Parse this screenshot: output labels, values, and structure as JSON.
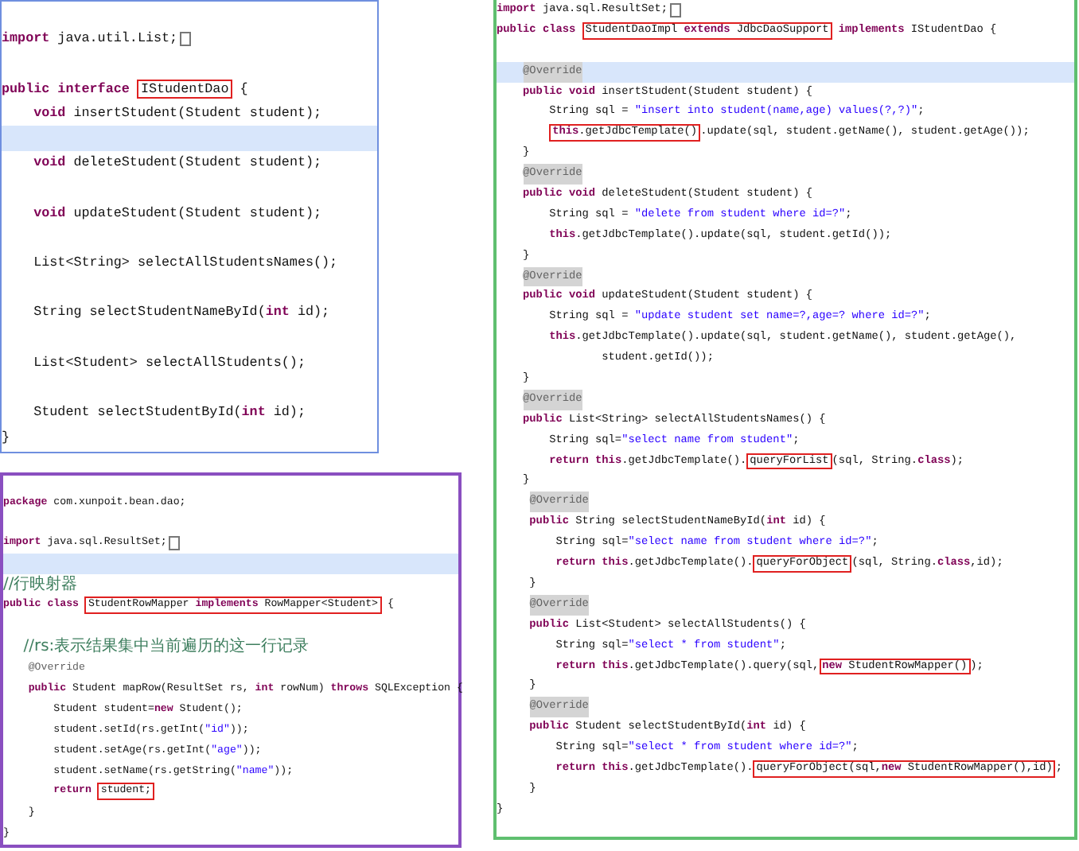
{
  "panels": [
    {
      "color": "#6f8fdf",
      "lines": [
        {
          "kind": "blank",
          "highlighted": false
        },
        {
          "kind": "code",
          "highlighted": false,
          "segments": [
            {
              "kind": "code",
              "tokens": [
                {
                  "kind": "keyword",
                  "text": "import"
                },
                {
                  "kind": "plain",
                  "text": " java.util.List;"
                }
              ]
            },
            {
              "kind": "fold"
            }
          ]
        },
        {
          "kind": "blank",
          "highlighted": false
        },
        {
          "kind": "code",
          "highlighted": false,
          "segments": [
            {
              "kind": "code",
              "tokens": [
                {
                  "kind": "keyword",
                  "text": "public interface "
                }
              ]
            },
            {
              "kind": "boxed",
              "tokens": [
                {
                  "kind": "plain",
                  "text": "IStudentDao"
                }
              ]
            },
            {
              "kind": "code",
              "tokens": [
                {
                  "kind": "plain",
                  "text": " {"
                }
              ]
            }
          ]
        },
        {
          "kind": "code",
          "highlighted": false,
          "segments": [
            {
              "kind": "code",
              "tokens": [
                {
                  "kind": "keyword",
                  "text": "    void"
                },
                {
                  "kind": "plain",
                  "text": " insertStudent(Student student);"
                }
              ]
            }
          ]
        },
        {
          "kind": "blank",
          "highlighted": true
        },
        {
          "kind": "code",
          "highlighted": false,
          "segments": [
            {
              "kind": "code",
              "tokens": [
                {
                  "kind": "keyword",
                  "text": "    void"
                },
                {
                  "kind": "plain",
                  "text": " deleteStudent(Student student);"
                }
              ]
            }
          ]
        },
        {
          "kind": "blank",
          "highlighted": false
        },
        {
          "kind": "code",
          "highlighted": false,
          "segments": [
            {
              "kind": "code",
              "tokens": [
                {
                  "kind": "keyword",
                  "text": "    void"
                },
                {
                  "kind": "plain",
                  "text": " updateStudent(Student student);"
                }
              ]
            }
          ]
        },
        {
          "kind": "blank",
          "highlighted": false
        },
        {
          "kind": "code",
          "highlighted": false,
          "segments": [
            {
              "kind": "code",
              "tokens": [
                {
                  "kind": "plain",
                  "text": "    List<String> selectAllStudentsNames();"
                }
              ]
            }
          ]
        },
        {
          "kind": "blank",
          "highlighted": false
        },
        {
          "kind": "code",
          "highlighted": false,
          "segments": [
            {
              "kind": "code",
              "tokens": [
                {
                  "kind": "plain",
                  "text": "    String selectStudentNameById("
                },
                {
                  "kind": "keyword",
                  "text": "int"
                },
                {
                  "kind": "plain",
                  "text": " id);"
                }
              ]
            }
          ]
        },
        {
          "kind": "blank",
          "highlighted": false
        },
        {
          "kind": "code",
          "highlighted": false,
          "segments": [
            {
              "kind": "code",
              "tokens": [
                {
                  "kind": "plain",
                  "text": "    List<Student> selectAllStudents();"
                }
              ]
            }
          ]
        },
        {
          "kind": "blank",
          "highlighted": false
        },
        {
          "kind": "code",
          "highlighted": false,
          "segments": [
            {
              "kind": "code",
              "tokens": [
                {
                  "kind": "plain",
                  "text": "    Student selectStudentById("
                },
                {
                  "kind": "keyword",
                  "text": "int"
                },
                {
                  "kind": "plain",
                  "text": " id);"
                }
              ]
            }
          ]
        },
        {
          "kind": "code",
          "highlighted": false,
          "segments": [
            {
              "kind": "code",
              "tokens": [
                {
                  "kind": "plain",
                  "text": "}"
                }
              ]
            }
          ]
        }
      ]
    },
    {
      "color": "#8a4fc0",
      "lines": [
        {
          "kind": "code",
          "highlighted": false,
          "segments": [
            {
              "kind": "code",
              "tokens": [
                {
                  "kind": "keyword",
                  "text": "package"
                },
                {
                  "kind": "plain",
                  "text": " com.xunpoit.bean.dao;"
                }
              ]
            }
          ]
        },
        {
          "kind": "blank",
          "highlighted": false
        },
        {
          "kind": "code",
          "highlighted": false,
          "segments": [
            {
              "kind": "code",
              "tokens": [
                {
                  "kind": "keyword",
                  "text": "import"
                },
                {
                  "kind": "plain",
                  "text": " java.sql.ResultSet;"
                }
              ]
            },
            {
              "kind": "fold"
            }
          ]
        },
        {
          "kind": "blank",
          "highlighted": true
        },
        {
          "kind": "code",
          "highlighted": false,
          "segments": [
            {
              "kind": "code",
              "tokens": [
                {
                  "kind": "comment",
                  "text": "//行映射器"
                }
              ]
            }
          ]
        },
        {
          "kind": "code",
          "highlighted": false,
          "segments": [
            {
              "kind": "code",
              "tokens": [
                {
                  "kind": "keyword",
                  "text": "public class "
                }
              ]
            },
            {
              "kind": "boxed",
              "tokens": [
                {
                  "kind": "plain",
                  "text": "StudentRowMapper "
                },
                {
                  "kind": "keyword",
                  "text": "implements"
                },
                {
                  "kind": "plain",
                  "text": " RowMapper<Student>"
                }
              ]
            },
            {
              "kind": "code",
              "tokens": [
                {
                  "kind": "plain",
                  "text": " {"
                }
              ]
            }
          ]
        },
        {
          "kind": "blank",
          "highlighted": false
        },
        {
          "kind": "code",
          "highlighted": false,
          "segments": [
            {
              "kind": "code",
              "tokens": [
                {
                  "kind": "comment",
                  "text": "    //rs:表示结果集中当前遍历的这一行记录"
                }
              ]
            }
          ]
        },
        {
          "kind": "code",
          "highlighted": false,
          "segments": [
            {
              "kind": "code",
              "tokens": [
                {
                  "kind": "annotation",
                  "text": "    @Override"
                }
              ]
            }
          ]
        },
        {
          "kind": "code",
          "highlighted": false,
          "segments": [
            {
              "kind": "code",
              "tokens": [
                {
                  "kind": "keyword",
                  "text": "    public"
                },
                {
                  "kind": "plain",
                  "text": " Student mapRow(ResultSet rs, "
                },
                {
                  "kind": "keyword",
                  "text": "int"
                },
                {
                  "kind": "plain",
                  "text": " rowNum) "
                },
                {
                  "kind": "keyword",
                  "text": "throws"
                },
                {
                  "kind": "plain",
                  "text": " SQLException {"
                }
              ]
            }
          ]
        },
        {
          "kind": "code",
          "highlighted": false,
          "segments": [
            {
              "kind": "code",
              "tokens": [
                {
                  "kind": "plain",
                  "text": "        Student student="
                },
                {
                  "kind": "keyword",
                  "text": "new"
                },
                {
                  "kind": "plain",
                  "text": " Student();"
                }
              ]
            }
          ]
        },
        {
          "kind": "code",
          "highlighted": false,
          "segments": [
            {
              "kind": "code",
              "tokens": [
                {
                  "kind": "plain",
                  "text": "        student.setId(rs.getInt("
                },
                {
                  "kind": "string",
                  "text": "\"id\""
                },
                {
                  "kind": "plain",
                  "text": "));"
                }
              ]
            }
          ]
        },
        {
          "kind": "code",
          "highlighted": false,
          "segments": [
            {
              "kind": "code",
              "tokens": [
                {
                  "kind": "plain",
                  "text": "        student.setAge(rs.getInt("
                },
                {
                  "kind": "string",
                  "text": "\"age\""
                },
                {
                  "kind": "plain",
                  "text": "));"
                }
              ]
            }
          ]
        },
        {
          "kind": "code",
          "highlighted": false,
          "segments": [
            {
              "kind": "code",
              "tokens": [
                {
                  "kind": "plain",
                  "text": "        student.setName(rs.getString("
                },
                {
                  "kind": "string",
                  "text": "\"name\""
                },
                {
                  "kind": "plain",
                  "text": "));"
                }
              ]
            }
          ]
        },
        {
          "kind": "code",
          "highlighted": false,
          "segments": [
            {
              "kind": "code",
              "tokens": [
                {
                  "kind": "keyword",
                  "text": "        return "
                }
              ]
            },
            {
              "kind": "boxed",
              "tokens": [
                {
                  "kind": "plain",
                  "text": "student;"
                }
              ]
            }
          ]
        },
        {
          "kind": "code",
          "highlighted": false,
          "segments": [
            {
              "kind": "code",
              "tokens": [
                {
                  "kind": "plain",
                  "text": "    }"
                }
              ]
            }
          ]
        },
        {
          "kind": "code",
          "highlighted": false,
          "segments": [
            {
              "kind": "code",
              "tokens": [
                {
                  "kind": "plain",
                  "text": "}"
                }
              ]
            }
          ]
        }
      ]
    },
    {
      "color": "#5fbf6f",
      "lines": [
        {
          "kind": "code",
          "highlighted": false,
          "segments": [
            {
              "kind": "code",
              "tokens": [
                {
                  "kind": "keyword",
                  "text": "import"
                },
                {
                  "kind": "plain",
                  "text": " java.sql.ResultSet;"
                }
              ]
            },
            {
              "kind": "fold"
            }
          ]
        },
        {
          "kind": "code",
          "highlighted": false,
          "segments": [
            {
              "kind": "code",
              "tokens": [
                {
                  "kind": "keyword",
                  "text": "public class "
                }
              ]
            },
            {
              "kind": "boxed",
              "tokens": [
                {
                  "kind": "plain",
                  "text": "StudentDaoImpl "
                },
                {
                  "kind": "keyword",
                  "text": "extends"
                },
                {
                  "kind": "plain",
                  "text": " JdbcDaoSupport"
                }
              ]
            },
            {
              "kind": "code",
              "tokens": [
                {
                  "kind": "keyword",
                  "text": " implements"
                },
                {
                  "kind": "plain",
                  "text": " IStudentDao {"
                }
              ]
            }
          ]
        },
        {
          "kind": "blank",
          "highlighted": false
        },
        {
          "kind": "code",
          "highlighted": true,
          "segments": [
            {
              "kind": "code",
              "tokens": [
                {
                  "kind": "marked_annotation",
                  "text": "    @Override"
                }
              ]
            }
          ]
        },
        {
          "kind": "code",
          "highlighted": false,
          "segments": [
            {
              "kind": "code",
              "tokens": [
                {
                  "kind": "keyword",
                  "text": "    public void"
                },
                {
                  "kind": "plain",
                  "text": " insertStudent(Student student) {"
                }
              ]
            }
          ]
        },
        {
          "kind": "code",
          "highlighted": false,
          "segments": [
            {
              "kind": "code",
              "tokens": [
                {
                  "kind": "plain",
                  "text": "        String sql = "
                },
                {
                  "kind": "string",
                  "text": "\"insert into student(name,age) values(?,?)\""
                },
                {
                  "kind": "plain",
                  "text": ";"
                }
              ]
            }
          ]
        },
        {
          "kind": "code",
          "highlighted": false,
          "segments": [
            {
              "kind": "boxed",
              "tokens": [
                {
                  "kind": "keyword",
                  "text": "        this"
                },
                {
                  "kind": "plain",
                  "text": ".getJdbcTemplate()"
                }
              ]
            },
            {
              "kind": "code",
              "tokens": [
                {
                  "kind": "plain",
                  "text": ".update(sql, student.getName(), student.getAge());"
                }
              ]
            }
          ]
        },
        {
          "kind": "code",
          "highlighted": false,
          "segments": [
            {
              "kind": "code",
              "tokens": [
                {
                  "kind": "plain",
                  "text": "    }"
                }
              ]
            }
          ]
        },
        {
          "kind": "code",
          "highlighted": false,
          "segments": [
            {
              "kind": "code",
              "tokens": [
                {
                  "kind": "marked_annotation",
                  "text": "    @Override"
                }
              ]
            }
          ]
        },
        {
          "kind": "code",
          "highlighted": false,
          "segments": [
            {
              "kind": "code",
              "tokens": [
                {
                  "kind": "keyword",
                  "text": "    public void"
                },
                {
                  "kind": "plain",
                  "text": " deleteStudent(Student student) {"
                }
              ]
            }
          ]
        },
        {
          "kind": "code",
          "highlighted": false,
          "segments": [
            {
              "kind": "code",
              "tokens": [
                {
                  "kind": "plain",
                  "text": "        String sql = "
                },
                {
                  "kind": "string",
                  "text": "\"delete from student where id=?\""
                },
                {
                  "kind": "plain",
                  "text": ";"
                }
              ]
            }
          ]
        },
        {
          "kind": "code",
          "highlighted": false,
          "segments": [
            {
              "kind": "code",
              "tokens": [
                {
                  "kind": "keyword",
                  "text": "        this"
                },
                {
                  "kind": "plain",
                  "text": ".getJdbcTemplate().update(sql, student.getId());"
                }
              ]
            }
          ]
        },
        {
          "kind": "code",
          "highlighted": false,
          "segments": [
            {
              "kind": "code",
              "tokens": [
                {
                  "kind": "plain",
                  "text": "    }"
                }
              ]
            }
          ]
        },
        {
          "kind": "code",
          "highlighted": false,
          "segments": [
            {
              "kind": "code",
              "tokens": [
                {
                  "kind": "marked_annotation",
                  "text": "    @Override"
                }
              ]
            }
          ]
        },
        {
          "kind": "code",
          "highlighted": false,
          "segments": [
            {
              "kind": "code",
              "tokens": [
                {
                  "kind": "keyword",
                  "text": "    public void"
                },
                {
                  "kind": "plain",
                  "text": " updateStudent(Student student) {"
                }
              ]
            }
          ]
        },
        {
          "kind": "code",
          "highlighted": false,
          "segments": [
            {
              "kind": "code",
              "tokens": [
                {
                  "kind": "plain",
                  "text": "        String sql = "
                },
                {
                  "kind": "string",
                  "text": "\"update student set name=?,age=? where id=?\""
                },
                {
                  "kind": "plain",
                  "text": ";"
                }
              ]
            }
          ]
        },
        {
          "kind": "code",
          "highlighted": false,
          "segments": [
            {
              "kind": "code",
              "tokens": [
                {
                  "kind": "keyword",
                  "text": "        this"
                },
                {
                  "kind": "plain",
                  "text": ".getJdbcTemplate().update(sql, student.getName(), student.getAge(),"
                }
              ]
            }
          ]
        },
        {
          "kind": "code",
          "highlighted": false,
          "segments": [
            {
              "kind": "code",
              "tokens": [
                {
                  "kind": "plain",
                  "text": "                student.getId());"
                }
              ]
            }
          ]
        },
        {
          "kind": "code",
          "highlighted": false,
          "segments": [
            {
              "kind": "code",
              "tokens": [
                {
                  "kind": "plain",
                  "text": "    }"
                }
              ]
            }
          ]
        },
        {
          "kind": "code",
          "highlighted": false,
          "segments": [
            {
              "kind": "code",
              "tokens": [
                {
                  "kind": "marked_annotation",
                  "text": "    @Override"
                }
              ]
            }
          ]
        },
        {
          "kind": "code",
          "highlighted": false,
          "segments": [
            {
              "kind": "code",
              "tokens": [
                {
                  "kind": "keyword",
                  "text": "    public"
                },
                {
                  "kind": "plain",
                  "text": " List<String> selectAllStudentsNames() {"
                }
              ]
            }
          ]
        },
        {
          "kind": "code",
          "highlighted": false,
          "segments": [
            {
              "kind": "code",
              "tokens": [
                {
                  "kind": "plain",
                  "text": "        String sql="
                },
                {
                  "kind": "string",
                  "text": "\"select name from student\""
                },
                {
                  "kind": "plain",
                  "text": ";"
                }
              ]
            }
          ]
        },
        {
          "kind": "code",
          "highlighted": false,
          "segments": [
            {
              "kind": "code",
              "tokens": [
                {
                  "kind": "keyword",
                  "text": "        return this"
                },
                {
                  "kind": "plain",
                  "text": ".getJdbcTemplate()."
                }
              ]
            },
            {
              "kind": "boxed",
              "tokens": [
                {
                  "kind": "plain",
                  "text": "queryForList"
                }
              ]
            },
            {
              "kind": "code",
              "tokens": [
                {
                  "kind": "plain",
                  "text": "(sql, String."
                },
                {
                  "kind": "keyword",
                  "text": "class"
                },
                {
                  "kind": "plain",
                  "text": ");"
                }
              ]
            }
          ]
        },
        {
          "kind": "code",
          "highlighted": false,
          "segments": [
            {
              "kind": "code",
              "tokens": [
                {
                  "kind": "plain",
                  "text": "    }"
                }
              ]
            }
          ]
        },
        {
          "kind": "code",
          "highlighted": false,
          "segments": [
            {
              "kind": "code",
              "tokens": [
                {
                  "kind": "marked_annotation",
                  "text": "     @Override"
                }
              ]
            }
          ]
        },
        {
          "kind": "code",
          "highlighted": false,
          "segments": [
            {
              "kind": "code",
              "tokens": [
                {
                  "kind": "keyword",
                  "text": "     public"
                },
                {
                  "kind": "plain",
                  "text": " String selectStudentNameById("
                },
                {
                  "kind": "keyword",
                  "text": "int"
                },
                {
                  "kind": "plain",
                  "text": " id) {"
                }
              ]
            }
          ]
        },
        {
          "kind": "code",
          "highlighted": false,
          "segments": [
            {
              "kind": "code",
              "tokens": [
                {
                  "kind": "plain",
                  "text": "         String sql="
                },
                {
                  "kind": "string",
                  "text": "\"select name from student where id=?\""
                },
                {
                  "kind": "plain",
                  "text": ";"
                }
              ]
            }
          ]
        },
        {
          "kind": "code",
          "highlighted": false,
          "segments": [
            {
              "kind": "code",
              "tokens": [
                {
                  "kind": "keyword",
                  "text": "         return this"
                },
                {
                  "kind": "plain",
                  "text": ".getJdbcTemplate()."
                }
              ]
            },
            {
              "kind": "boxed",
              "tokens": [
                {
                  "kind": "plain",
                  "text": "queryForObject"
                }
              ]
            },
            {
              "kind": "code",
              "tokens": [
                {
                  "kind": "plain",
                  "text": "(sql, String."
                },
                {
                  "kind": "keyword",
                  "text": "class"
                },
                {
                  "kind": "plain",
                  "text": ",id);"
                }
              ]
            }
          ]
        },
        {
          "kind": "code",
          "highlighted": false,
          "segments": [
            {
              "kind": "code",
              "tokens": [
                {
                  "kind": "plain",
                  "text": "     }"
                }
              ]
            }
          ]
        },
        {
          "kind": "code",
          "highlighted": false,
          "segments": [
            {
              "kind": "code",
              "tokens": [
                {
                  "kind": "marked_annotation",
                  "text": "     @Override"
                }
              ]
            }
          ]
        },
        {
          "kind": "code",
          "highlighted": false,
          "segments": [
            {
              "kind": "code",
              "tokens": [
                {
                  "kind": "keyword",
                  "text": "     public"
                },
                {
                  "kind": "plain",
                  "text": " List<Student> selectAllStudents() {"
                }
              ]
            }
          ]
        },
        {
          "kind": "code",
          "highlighted": false,
          "segments": [
            {
              "kind": "code",
              "tokens": [
                {
                  "kind": "plain",
                  "text": "         String sql="
                },
                {
                  "kind": "string",
                  "text": "\"select * from student\""
                },
                {
                  "kind": "plain",
                  "text": ";"
                }
              ]
            }
          ]
        },
        {
          "kind": "code",
          "highlighted": false,
          "segments": [
            {
              "kind": "code",
              "tokens": [
                {
                  "kind": "keyword",
                  "text": "         return this"
                },
                {
                  "kind": "plain",
                  "text": ".getJdbcTemplate().query(sql,"
                }
              ]
            },
            {
              "kind": "boxed",
              "tokens": [
                {
                  "kind": "keyword",
                  "text": "new"
                },
                {
                  "kind": "plain",
                  "text": " StudentRowMapper()"
                }
              ]
            },
            {
              "kind": "code",
              "tokens": [
                {
                  "kind": "plain",
                  "text": ");"
                }
              ]
            }
          ]
        },
        {
          "kind": "code",
          "highlighted": false,
          "segments": [
            {
              "kind": "code",
              "tokens": [
                {
                  "kind": "plain",
                  "text": "     }"
                }
              ]
            }
          ]
        },
        {
          "kind": "code",
          "highlighted": false,
          "segments": [
            {
              "kind": "code",
              "tokens": [
                {
                  "kind": "marked_annotation",
                  "text": "     @Override"
                }
              ]
            }
          ]
        },
        {
          "kind": "code",
          "highlighted": false,
          "segments": [
            {
              "kind": "code",
              "tokens": [
                {
                  "kind": "keyword",
                  "text": "     public"
                },
                {
                  "kind": "plain",
                  "text": " Student selectStudentById("
                },
                {
                  "kind": "keyword",
                  "text": "int"
                },
                {
                  "kind": "plain",
                  "text": " id) {"
                }
              ]
            }
          ]
        },
        {
          "kind": "code",
          "highlighted": false,
          "segments": [
            {
              "kind": "code",
              "tokens": [
                {
                  "kind": "plain",
                  "text": "         String sql="
                },
                {
                  "kind": "string",
                  "text": "\"select * from student where id=?\""
                },
                {
                  "kind": "plain",
                  "text": ";"
                }
              ]
            }
          ]
        },
        {
          "kind": "code",
          "highlighted": false,
          "segments": [
            {
              "kind": "code",
              "tokens": [
                {
                  "kind": "keyword",
                  "text": "         return this"
                },
                {
                  "kind": "plain",
                  "text": ".getJdbcTemplate()."
                }
              ]
            },
            {
              "kind": "boxed",
              "tokens": [
                {
                  "kind": "plain",
                  "text": "queryForObject(sql,"
                },
                {
                  "kind": "keyword",
                  "text": "new"
                },
                {
                  "kind": "plain",
                  "text": " StudentRowMapper(),id)"
                }
              ]
            },
            {
              "kind": "code",
              "tokens": [
                {
                  "kind": "plain",
                  "text": ";"
                }
              ]
            }
          ]
        },
        {
          "kind": "code",
          "highlighted": false,
          "segments": [
            {
              "kind": "code",
              "tokens": [
                {
                  "kind": "plain",
                  "text": "     }"
                }
              ]
            }
          ]
        },
        {
          "kind": "code",
          "highlighted": false,
          "segments": [
            {
              "kind": "code",
              "tokens": [
                {
                  "kind": "plain",
                  "text": "}"
                }
              ]
            }
          ]
        }
      ]
    }
  ]
}
